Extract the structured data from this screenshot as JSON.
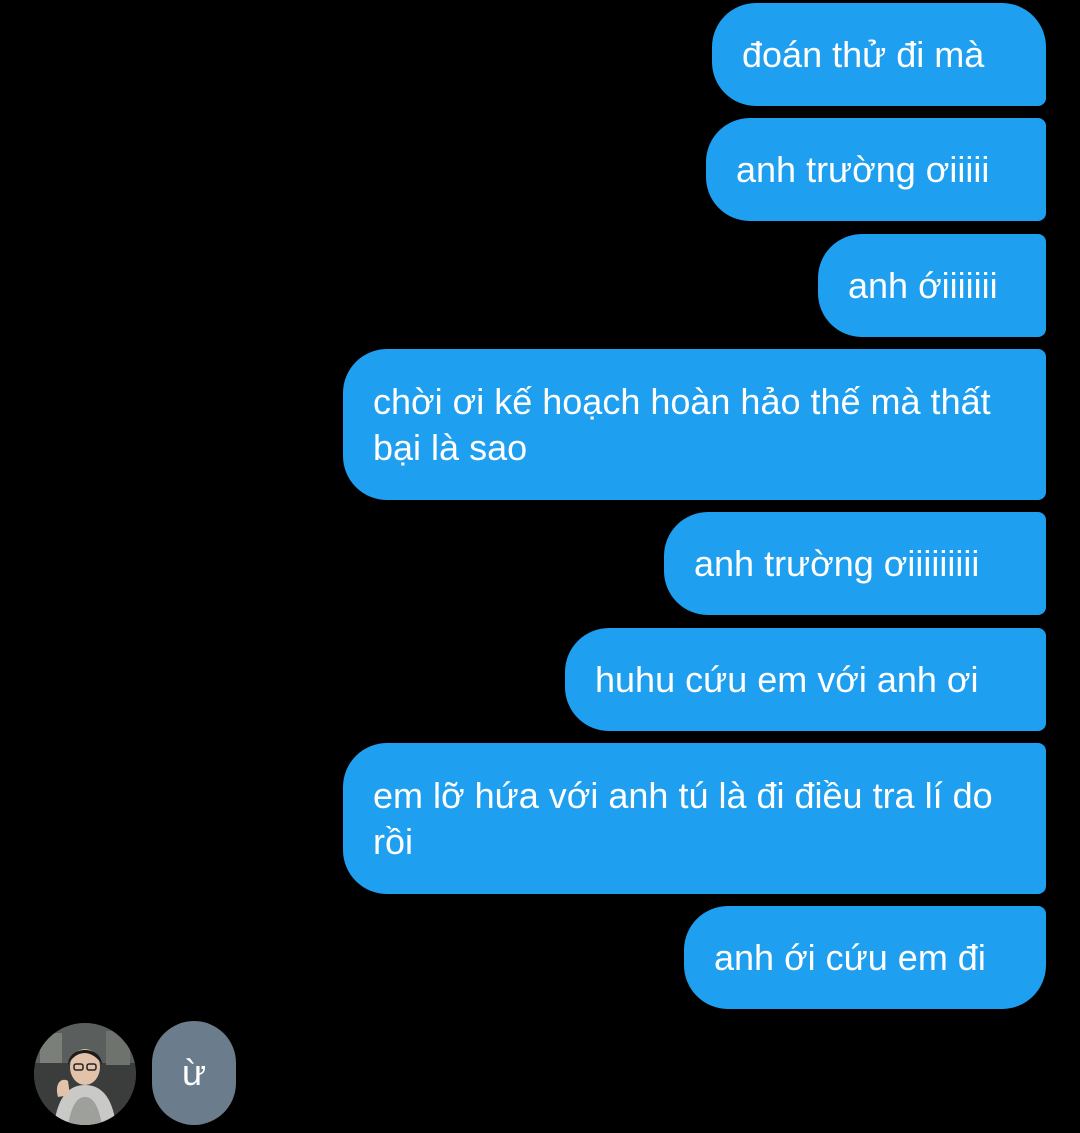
{
  "messages": {
    "outgoing": [
      "đoán thử đi mà",
      "anh trường ơiiiii",
      "anh ớiiiiiii",
      "chời ơi kế hoạch hoàn hảo thế mà thất bại là sao",
      "anh trường ơiiiiiiiii",
      "huhu cứu em với anh ơi",
      "em lỡ hứa với anh tú là đi điều tra lí do rồi",
      "anh ới cứu em đi"
    ],
    "incoming": [
      "ừ"
    ]
  },
  "colors": {
    "background": "#000000",
    "outgoing_bubble": "#1f9ff0",
    "incoming_bubble": "#6b7c8c",
    "text": "#ffffff"
  },
  "icons": {
    "avatar": "contact-avatar-photo"
  }
}
